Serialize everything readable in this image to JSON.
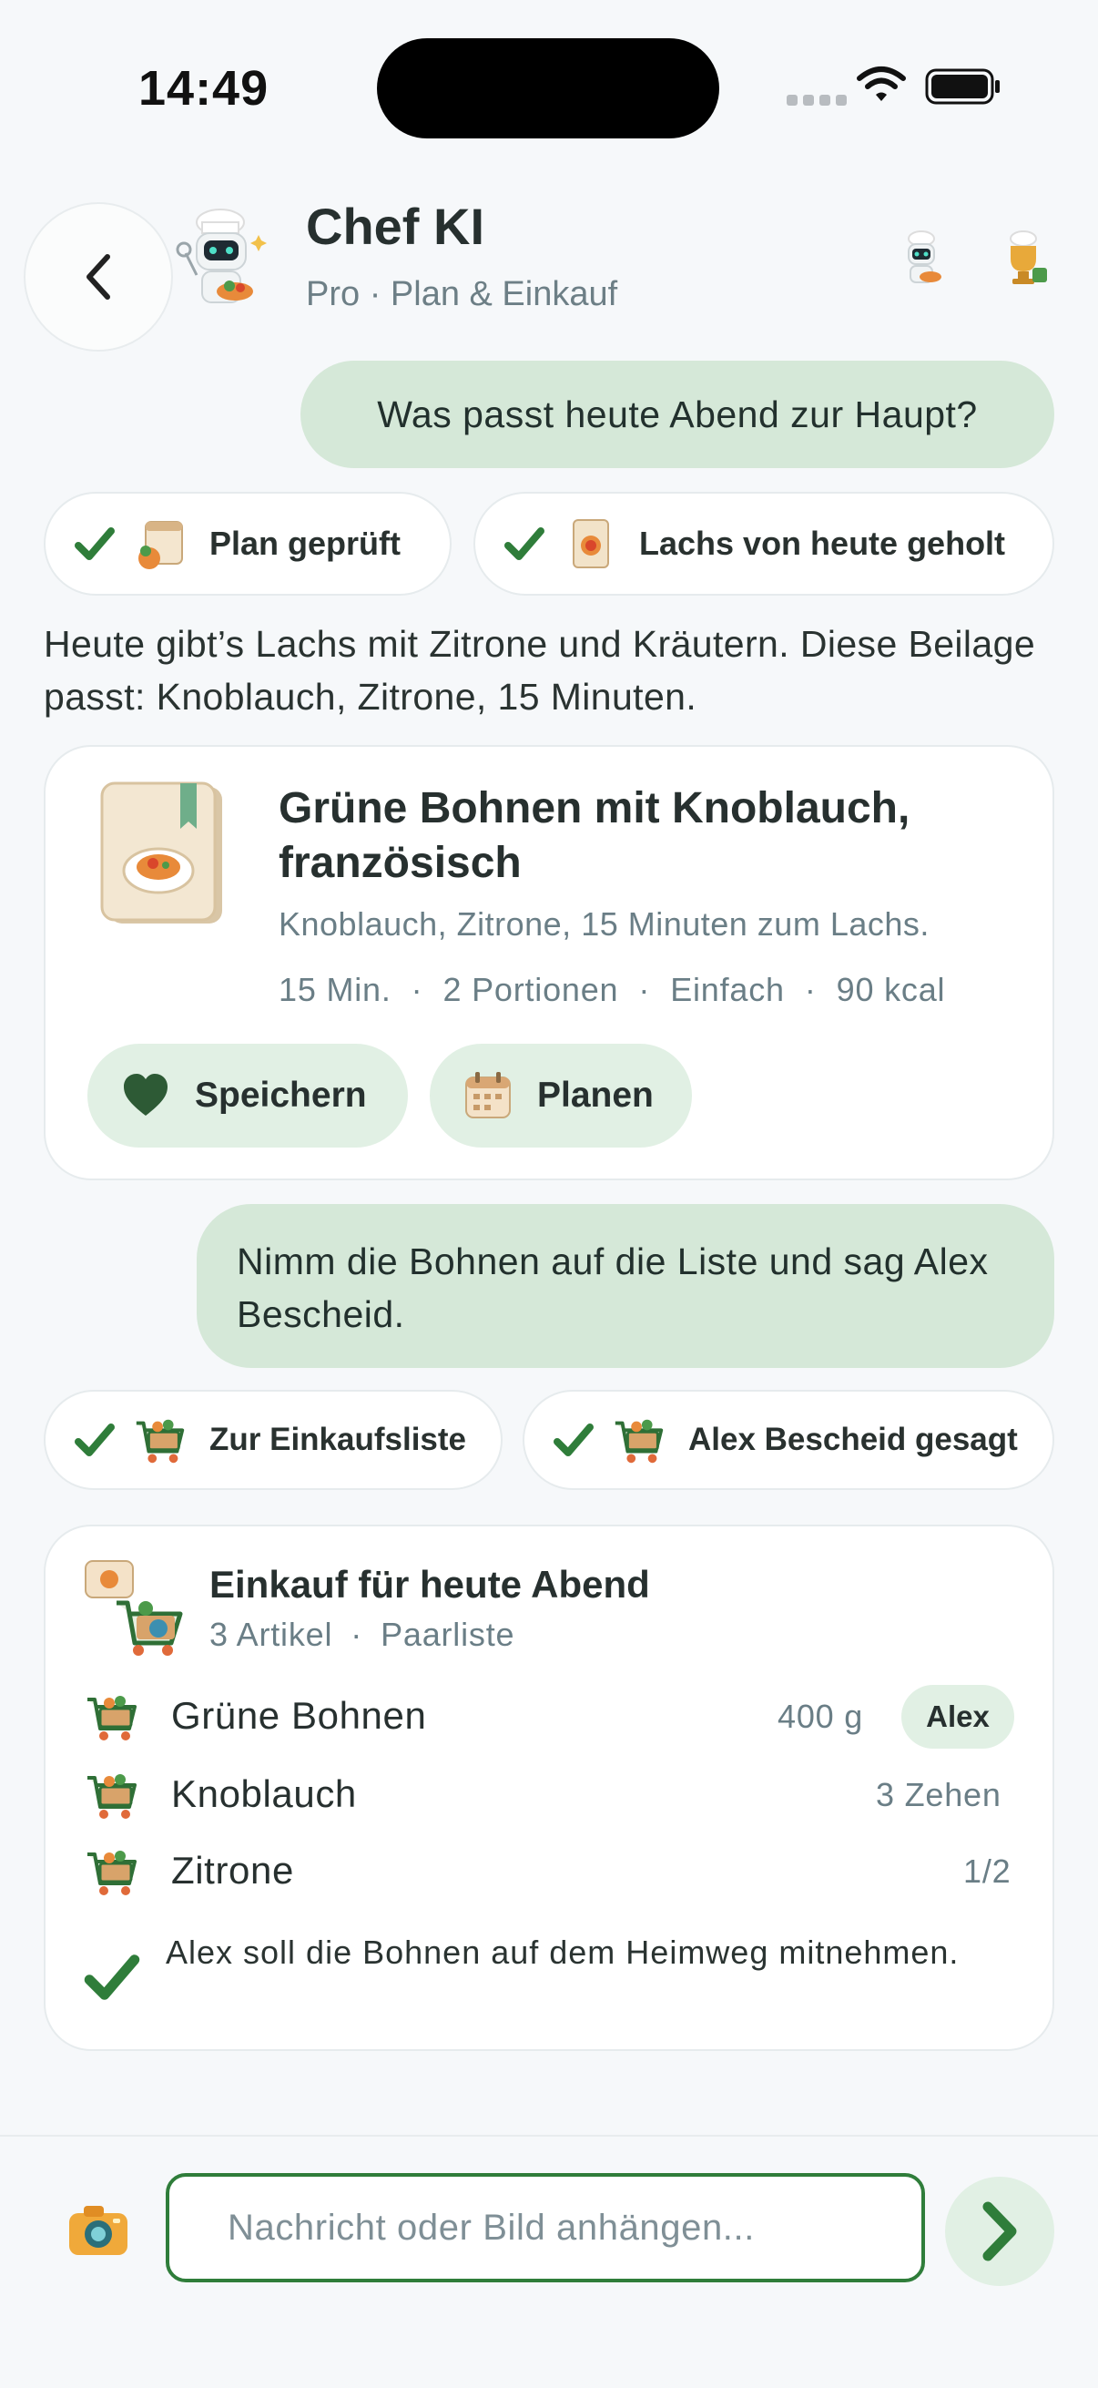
{
  "status": {
    "time": "14:49"
  },
  "header": {
    "title": "Chef KI",
    "subtitle": "Pro · Plan & Einkauf"
  },
  "chat": {
    "user_msg_1": "Was passt heute Abend zur Haupt?",
    "status_1": "Plan geprüft",
    "status_2": "Lachs von heute geholt",
    "answer": "Heute gibt’s Lachs mit Zitrone und Kräutern. Diese Beilage passt: Knoblauch, Zitrone, 15 Minuten.",
    "user_msg_2": "Nimm die Bohnen auf die Liste und sag Alex Bescheid.",
    "status_3": "Zur Einkaufsliste",
    "status_4": "Alex Bescheid gesagt"
  },
  "recipe": {
    "title": "Grüne Bohnen mit Knoblauch, französisch",
    "description": "Knoblauch, Zitrone, 15 Minuten zum Lachs.",
    "meta": [
      "15 Min.",
      "·",
      "2 Portionen",
      "·",
      "Einfach",
      "·",
      "90 kcal"
    ],
    "save_label": "Speichern",
    "plan_label": "Planen"
  },
  "shopping": {
    "title": "Einkauf für heute Abend",
    "count": "3 Artikel",
    "sep": "·",
    "list_type": "Paarliste",
    "items": [
      {
        "name": "Grüne Bohnen",
        "qty": "400 g",
        "assignee": "Alex"
      },
      {
        "name": "Knoblauch",
        "qty": "3 Zehen"
      },
      {
        "name": "Zitrone",
        "qty": "1/2"
      }
    ],
    "note": "Alex soll die Bohnen auf dem Heimweg mitnehmen."
  },
  "composer": {
    "placeholder": "Nachricht oder Bild anhängen..."
  },
  "colors": {
    "accent": "#2f7d3a",
    "bubble": "#d5e8d8",
    "pill": "#e1f0e4",
    "muted": "#6a7e86"
  }
}
